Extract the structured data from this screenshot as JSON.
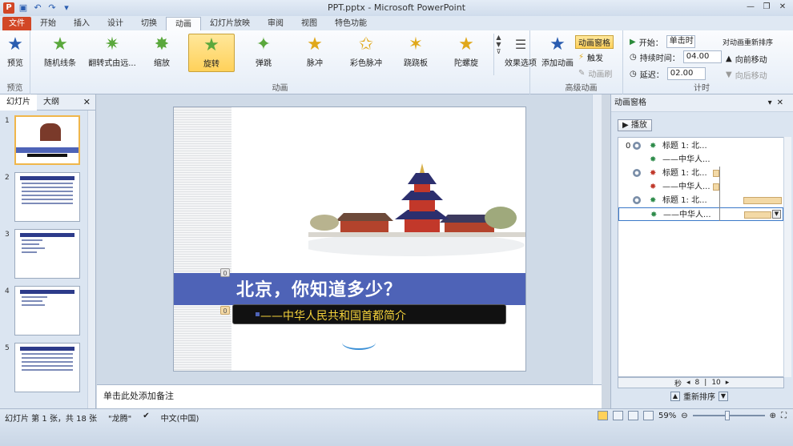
{
  "titlebar": {
    "title": "PPT.pptx - Microsoft PowerPoint"
  },
  "tabs": [
    "文件",
    "开始",
    "插入",
    "设计",
    "切换",
    "动画",
    "幻灯片放映",
    "审阅",
    "视图",
    "特色功能"
  ],
  "ribbon": {
    "preview": {
      "label": "预览",
      "group": "预览"
    },
    "animations": [
      "随机线条",
      "翻转式由远...",
      "缩放",
      "旋转",
      "弹跳",
      "脉冲",
      "彩色脉冲",
      "跷跷板",
      "陀螺旋"
    ],
    "effect_options": "效果选项",
    "animations_group": "动画",
    "add_animation": "添加动画",
    "anim_pane": "动画窗格",
    "trigger": "触发",
    "anim_painter": "动画刷",
    "advanced_group": "高级动画",
    "start_label": "开始：",
    "start_value": "单击时",
    "duration_label": "持续时间：",
    "duration_value": "04.00",
    "delay_label": "延迟：",
    "delay_value": "02.00",
    "reorder_title": "对动画重新排序",
    "move_earlier": "向前移动",
    "move_later": "向后移动",
    "timing_group": "计时"
  },
  "leftpanel": {
    "tab_slides": "幻灯片",
    "tab_outline": "大纲",
    "slide_nums": [
      "1",
      "2",
      "3",
      "4",
      "5"
    ]
  },
  "slide": {
    "title": "北京，你知道多少？",
    "subtitle": "——中华人民共和国首都简介",
    "tag_title": "0",
    "tag_sub": "0"
  },
  "notes": {
    "placeholder": "单击此处添加备注"
  },
  "animpane": {
    "title": "动画窗格",
    "play": "播放",
    "items": [
      {
        "num": "0",
        "label": "标题 1: 北..."
      },
      {
        "num": "",
        "label": "——中华人..."
      },
      {
        "num": "",
        "label": "标题 1: 北..."
      },
      {
        "num": "",
        "label": "——中华人..."
      },
      {
        "num": "",
        "label": "标题 1: 北..."
      },
      {
        "num": "",
        "label": "——中华人..."
      }
    ],
    "timeline_unit": "秒",
    "timeline_a": "8",
    "timeline_b": "10",
    "reorder": "重新排序"
  },
  "status": {
    "slide_info": "幻灯片 第 1 张，共 18 张",
    "theme": "\"龙腾\"",
    "lang": "中文(中国)",
    "zoom": "59%"
  }
}
